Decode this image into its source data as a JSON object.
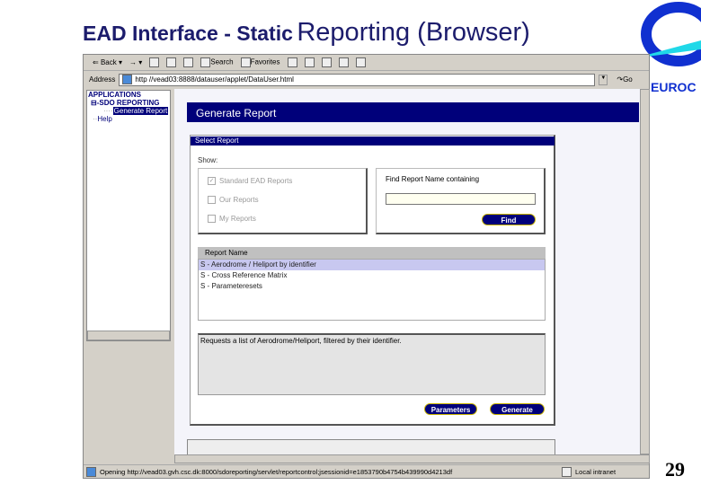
{
  "slide": {
    "title_part1": "EAD Interface - Static",
    "title_part2": "Reporting (Browser)",
    "page_number": "29",
    "logo_text": "EUROC"
  },
  "browser": {
    "toolbar": {
      "back": "Back",
      "search": "Search",
      "favorites": "Favorites"
    },
    "address_label": "Address",
    "url": "http //vead03:8888/datauser/applet/DataUser.html",
    "go": "Go",
    "status_text": "Opening http://vead03.gvh.csc.dk:8000/sdoreporting/servlet/reportcontrol;jsessionid=e1853790b4754b439990d4213df",
    "zone": "Local intranet"
  },
  "tree": {
    "root": "APPLICATIONS",
    "group": "SDO REPORTING",
    "item": "Generate Report",
    "help": "Help"
  },
  "page": {
    "header": "Generate Report",
    "panel_title": "Select Report",
    "show_label": "Show:",
    "checkboxes": [
      {
        "label": "Standard EAD Reports",
        "checked": true
      },
      {
        "label": "Our Reports",
        "checked": false
      },
      {
        "label": "My Reports",
        "checked": false
      }
    ],
    "find_label": "Find Report Name containing",
    "find_value": "",
    "find_button": "Find",
    "table_header": "Report Name",
    "reports": [
      "S - Aerodrome / Heliport by identifier",
      "S - Cross Reference Matrix",
      "S - Parameteresets"
    ],
    "selected_index": 0,
    "description": "Requests a list of Aerodrome/Heliport, filtered by their identifier.",
    "parameters_button": "Parameters",
    "generate_button": "Generate"
  },
  "colors": {
    "navy": "#00007a",
    "title": "#1c1c6c",
    "selected": "#c8c8f0"
  }
}
